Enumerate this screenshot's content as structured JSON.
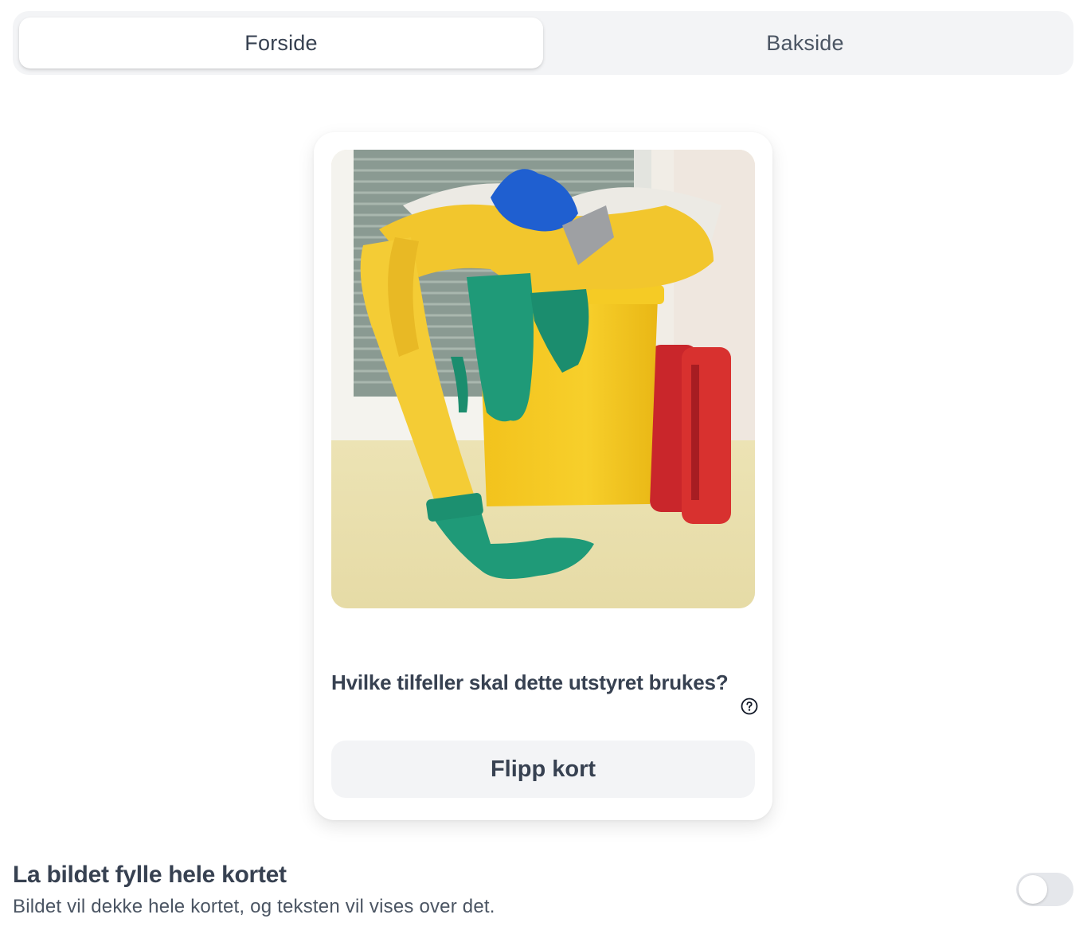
{
  "tabs": [
    {
      "label": "Forside",
      "active": true
    },
    {
      "label": "Bakside",
      "active": false
    }
  ],
  "card": {
    "image_icon": "photo-of-protective-equipment",
    "question": "Hvilke tilfeller skal dette utstyret brukes?",
    "help_icon": "question-circle-icon",
    "flip_label": "Flipp kort"
  },
  "setting": {
    "title": "La bildet fylle hele kortet",
    "description": "Bildet vil dekke hele kortet, og teksten vil vises over det.",
    "enabled": false
  },
  "colors": {
    "tab_track": "#f3f4f6",
    "text": "#374151",
    "toggle_off": "#e5e7eb"
  }
}
